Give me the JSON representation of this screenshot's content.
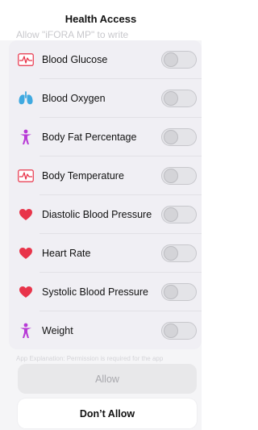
{
  "header": {
    "title": "Health Access",
    "subtitle": "Allow \"iFORA MP\" to write"
  },
  "items": [
    {
      "label": "Blood Glucose",
      "icon": "ecg-chart-icon",
      "enabled": false
    },
    {
      "label": "Blood Oxygen",
      "icon": "lungs-icon",
      "enabled": false
    },
    {
      "label": "Body Fat Percentage",
      "icon": "person-figure-icon",
      "enabled": false
    },
    {
      "label": "Body Temperature",
      "icon": "ecg-chart-icon",
      "enabled": false
    },
    {
      "label": "Diastolic Blood Pressure",
      "icon": "heart-icon",
      "enabled": false
    },
    {
      "label": "Heart Rate",
      "icon": "heart-icon",
      "enabled": false
    },
    {
      "label": "Systolic Blood Pressure",
      "icon": "heart-icon",
      "enabled": false
    },
    {
      "label": "Weight",
      "icon": "person-figure-icon",
      "enabled": false
    }
  ],
  "footnote": "App Explanation: Permission is required for the app",
  "buttons": {
    "allow": "Allow",
    "deny": "Don’t Allow"
  },
  "colors": {
    "heart": "#e8344a",
    "lungs": "#3fa9e0",
    "figure": "#b73ad6",
    "ecg": "#e8344a"
  }
}
